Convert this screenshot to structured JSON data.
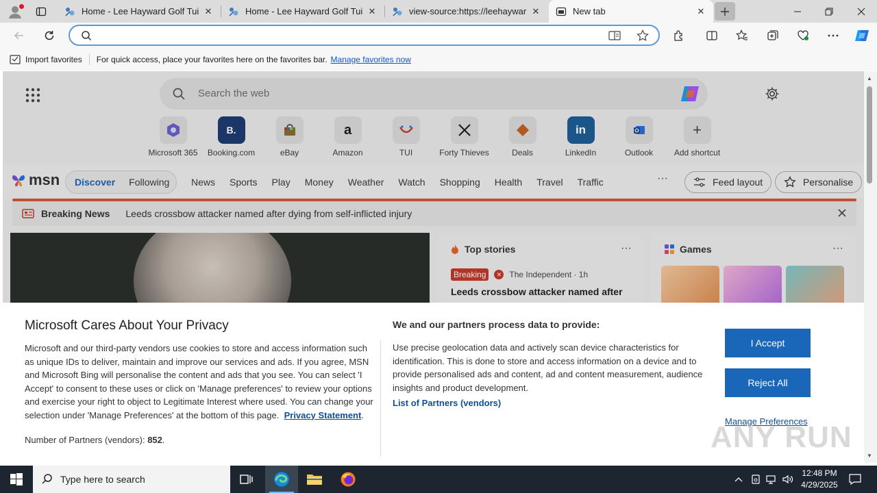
{
  "browser": {
    "tabs": [
      {
        "title": "Home - Lee Hayward Golf Tuition",
        "active": false
      },
      {
        "title": "Home - Lee Hayward Golf Tuition",
        "active": false
      },
      {
        "title": "view-source:https://leehaywardgolf",
        "active": false
      },
      {
        "title": "New tab",
        "active": true
      }
    ],
    "address": {
      "value": "",
      "placeholder": ""
    }
  },
  "favorites_bar": {
    "import_label": "Import favorites",
    "hint": "For quick access, place your favorites here on the favorites bar.",
    "manage_link": "Manage favorites now"
  },
  "newtab": {
    "search_placeholder": "Search the web",
    "shortcuts": [
      {
        "label": "Microsoft 365",
        "icon": "microsoft-365-icon"
      },
      {
        "label": "Booking.com",
        "icon": "booking-icon",
        "glyph": "B."
      },
      {
        "label": "eBay",
        "icon": "ebay-icon"
      },
      {
        "label": "Amazon",
        "icon": "amazon-icon",
        "glyph": "a"
      },
      {
        "label": "TUI",
        "icon": "tui-icon"
      },
      {
        "label": "Forty Thieves",
        "icon": "forty-thieves-icon"
      },
      {
        "label": "Deals",
        "icon": "deals-icon"
      },
      {
        "label": "LinkedIn",
        "icon": "linkedin-icon",
        "glyph": "in"
      },
      {
        "label": "Outlook",
        "icon": "outlook-icon"
      },
      {
        "label": "Add shortcut",
        "icon": "plus-icon",
        "glyph": "+"
      }
    ]
  },
  "msn": {
    "logo": "msn",
    "discover": "Discover",
    "following": "Following",
    "nav": [
      "News",
      "Sports",
      "Play",
      "Money",
      "Weather",
      "Watch",
      "Shopping",
      "Health",
      "Travel",
      "Traffic"
    ],
    "more": "···",
    "feed_layout": "Feed layout",
    "personalise": "Personalise",
    "breaking_label": "Breaking News",
    "breaking_text": "Leeds crossbow attacker named after dying from self-inflicted injury",
    "top_stories": {
      "heading": "Top stories",
      "badge": "Breaking",
      "source": "The Independent · 1h",
      "headline": "Leeds crossbow attacker named after"
    },
    "games": {
      "heading": "Games"
    },
    "card_menu": "···"
  },
  "privacy": {
    "title": "Microsoft Cares About Your Privacy",
    "body": "Microsoft and our third-party vendors use cookies to store and access information such as unique IDs to deliver, maintain and improve our services and ads. If you agree, MSN and Microsoft Bing will personalise the content and ads that you see. You can select 'I Accept' to consent to these uses or click on 'Manage preferences' to review your options and exercise your right to object to Legitimate Interest where used.  You can change your selection under 'Manage Preferences' at the bottom of this page.",
    "privacy_link": "Privacy Statement",
    "partners_label": "Number of Partners (vendors):",
    "partners_count": "852",
    "right_title": "We and our partners process data to provide:",
    "right_body": "Use precise geolocation data and actively scan device characteristics for identification. This is done to store and access information on a device and to provide personalised ads and content, ad and content measurement, audience insights and product development.",
    "vendors_link": "List of Partners (vendors)",
    "accept": "I Accept",
    "reject": "Reject All",
    "manage": "Manage Preferences"
  },
  "watermark": "ANY RUN",
  "taskbar": {
    "search_placeholder": "Type here to search",
    "time": "12:48 PM",
    "date": "4/29/2025"
  },
  "colors": {
    "accent": "#1a66b8",
    "link": "#0f4f95",
    "breaking": "#c0392b",
    "taskbar": "#1c2530"
  }
}
